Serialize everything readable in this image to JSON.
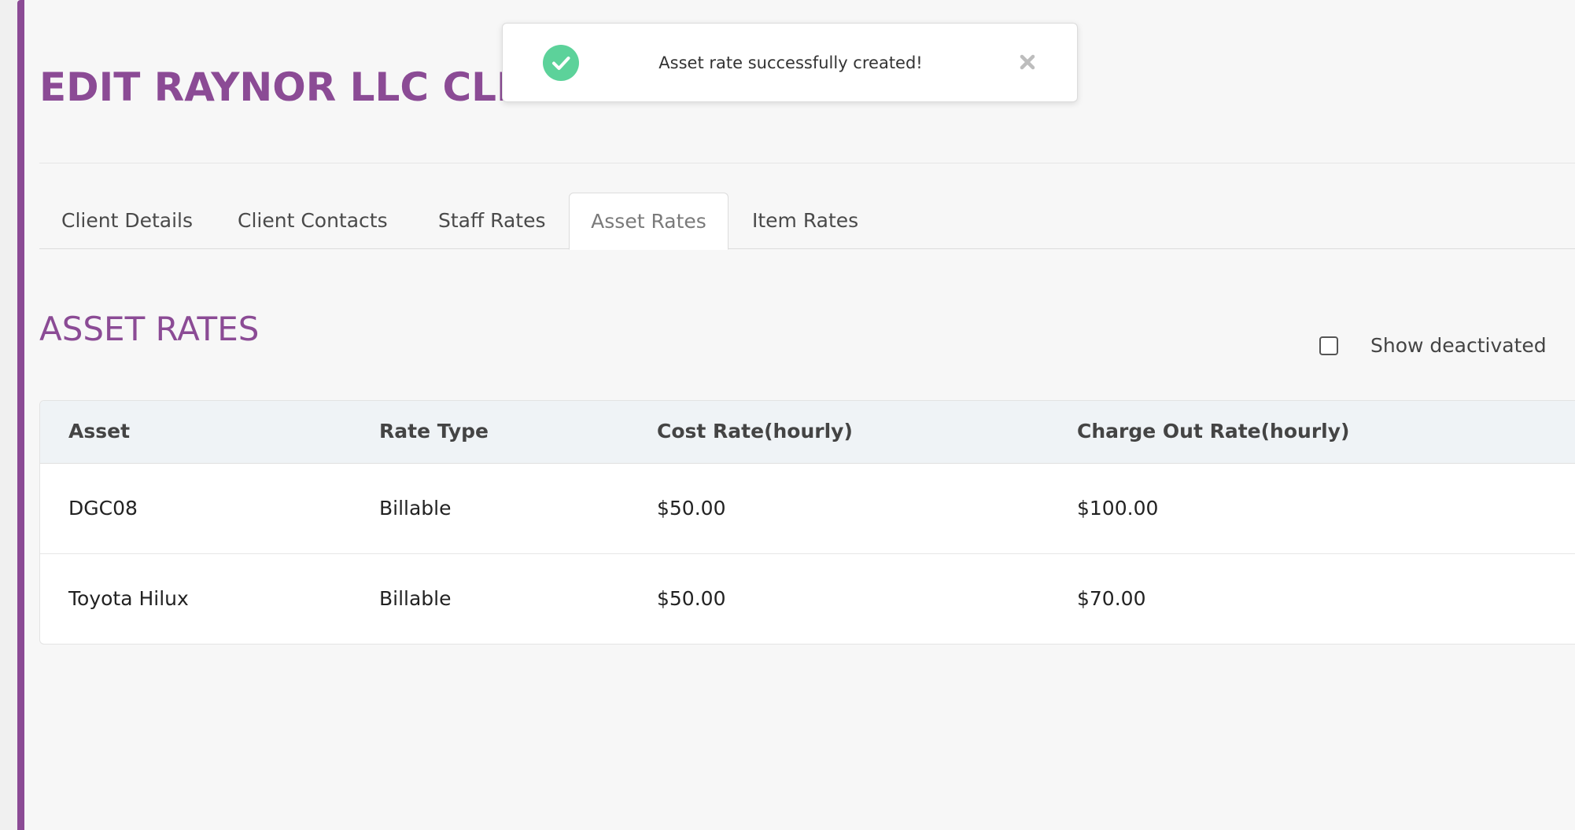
{
  "page": {
    "title": "EDIT RAYNOR LLC CLIENT"
  },
  "toast": {
    "message": "Asset rate successfully created!",
    "icon": "check-circle-icon",
    "close_icon": "close-icon",
    "color": "#5cd29a"
  },
  "tabs": [
    {
      "label": "Client Details",
      "active": false
    },
    {
      "label": "Client Contacts",
      "active": false
    },
    {
      "label": "Staff Rates",
      "active": false
    },
    {
      "label": "Asset Rates",
      "active": true
    },
    {
      "label": "Item Rates",
      "active": false
    }
  ],
  "section": {
    "title": "ASSET RATES",
    "show_deactivated_label": "Show deactivated",
    "show_deactivated_checked": false
  },
  "table": {
    "headers": [
      "Asset",
      "Rate Type",
      "Cost Rate(hourly)",
      "Charge Out Rate(hourly)"
    ],
    "rows": [
      [
        "DGC08",
        "Billable",
        "$50.00",
        "$100.00"
      ],
      [
        "Toyota Hilux",
        "Billable",
        "$50.00",
        "$70.00"
      ]
    ]
  },
  "colors": {
    "accent": "#8b4b95",
    "header_bg": "#eff3f6",
    "success": "#5cd29a"
  }
}
